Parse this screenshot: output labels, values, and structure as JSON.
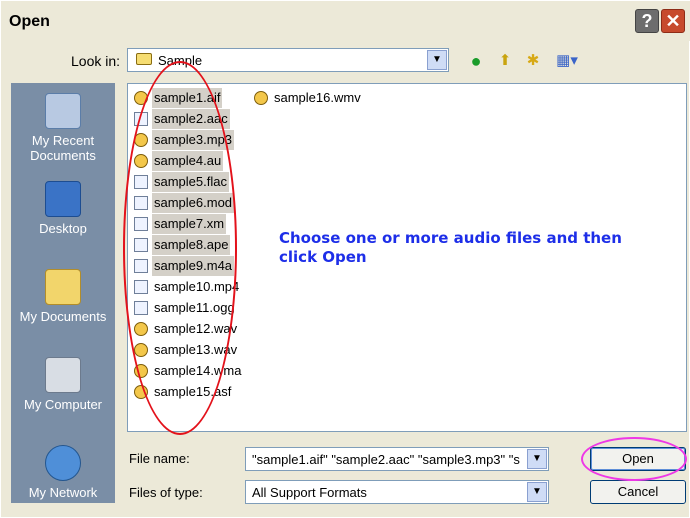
{
  "window": {
    "title": "Open",
    "help_glyph": "?",
    "close_glyph": "✕"
  },
  "toolbar": {
    "lookin_label": "Look in:",
    "lookin_value": "Sample",
    "icons": [
      "back-icon",
      "up-folder-icon",
      "new-folder-icon",
      "views-menu-icon"
    ]
  },
  "places": [
    {
      "label": "My Recent Documents",
      "icon": "recent-documents-icon"
    },
    {
      "label": "Desktop",
      "icon": "desktop-icon"
    },
    {
      "label": "My Documents",
      "icon": "my-documents-icon"
    },
    {
      "label": "My Computer",
      "icon": "my-computer-icon"
    },
    {
      "label": "My Network",
      "icon": "my-network-icon"
    }
  ],
  "files": [
    {
      "name": "sample1.aif",
      "selected": true
    },
    {
      "name": "sample2.aac",
      "selected": true
    },
    {
      "name": "sample3.mp3",
      "selected": true
    },
    {
      "name": "sample4.au",
      "selected": true
    },
    {
      "name": "sample5.flac",
      "selected": true
    },
    {
      "name": "sample6.mod",
      "selected": true
    },
    {
      "name": "sample7.xm",
      "selected": true
    },
    {
      "name": "sample8.ape",
      "selected": true
    },
    {
      "name": "sample9.m4a",
      "selected": true
    },
    {
      "name": "sample10.mp4",
      "selected": false
    },
    {
      "name": "sample11.ogg",
      "selected": false
    },
    {
      "name": "sample12.wav",
      "selected": false
    },
    {
      "name": "sample13.wav",
      "selected": false
    },
    {
      "name": "sample14.wma",
      "selected": false
    },
    {
      "name": "sample15.asf",
      "selected": false
    },
    {
      "name": "sample16.wmv",
      "selected": false
    }
  ],
  "instructions": "Choose one or more audio files and then click Open",
  "form": {
    "filename_label": "File name:",
    "filename_value": "\"sample1.aif\" \"sample2.aac\" \"sample3.mp3\" \"s",
    "filetype_label": "Files of type:",
    "filetype_value": "All Support Formats",
    "open_label": "Open",
    "cancel_label": "Cancel"
  },
  "annotations": {
    "oval_colors": [
      "#e3121b",
      "#ee38e6"
    ]
  }
}
